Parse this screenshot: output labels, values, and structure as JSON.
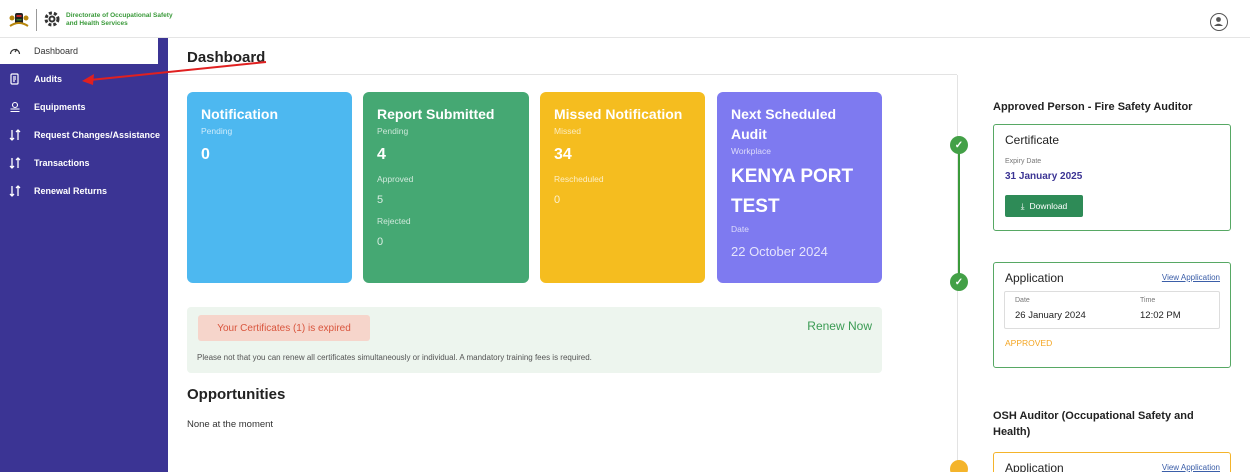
{
  "header": {
    "org_name_line1": "Directorate of Occupational Safety",
    "org_name_line2": "and Health Services"
  },
  "sidebar": {
    "items": [
      {
        "label": "Dashboard",
        "icon": "gauge-icon",
        "active": true
      },
      {
        "label": "Audits",
        "icon": "document-icon"
      },
      {
        "label": "Equipments",
        "icon": "gear-stack-icon"
      },
      {
        "label": "Request Changes/Assistance",
        "icon": "transfer-icon"
      },
      {
        "label": "Transactions",
        "icon": "transfer-icon"
      },
      {
        "label": "Renewal Returns",
        "icon": "transfer-icon"
      }
    ]
  },
  "page": {
    "title": "Dashboard"
  },
  "cards": {
    "notification": {
      "title": "Notification",
      "sub": "Pending",
      "value": "0",
      "color": "#4db8f0"
    },
    "report": {
      "title": "Report Submitted",
      "pending_label": "Pending",
      "pending_value": "4",
      "approved_label": "Approved",
      "approved_value": "5",
      "rejected_label": "Rejected",
      "rejected_value": "0",
      "color": "#45a873"
    },
    "missed": {
      "title": "Missed Notification",
      "missed_label": "Missed",
      "missed_value": "34",
      "rescheduled_label": "Rescheduled",
      "rescheduled_value": "0",
      "color": "#f5bd1f"
    },
    "scheduled": {
      "title_line1": "Next Scheduled",
      "title_line2": "Audit",
      "workplace_label": "Workplace",
      "workplace_line1": "KENYA PORT",
      "workplace_line2": "TEST",
      "date_label": "Date",
      "date_value": "22 October 2024",
      "color": "#7e7af0"
    }
  },
  "alert": {
    "expired_text": "Your Certificates (1) is expired",
    "renew_label": "Renew Now",
    "note": "Please not that you can renew all certificates simultaneously or individual. A mandatory training fees is required."
  },
  "opportunities": {
    "title": "Opportunities",
    "empty_text": "None at the moment"
  },
  "right_panel": {
    "section1_title": "Approved Person - Fire Safety Auditor",
    "certificate": {
      "title": "Certificate",
      "expiry_label": "Expiry Date",
      "expiry_value": "31 January 2025",
      "download_label": "Download"
    },
    "application": {
      "title": "Application",
      "link": "View Application",
      "date_label": "Date",
      "date_value": "26 January 2024",
      "time_label": "Time",
      "time_value": "12:02 PM",
      "status": "APPROVED"
    },
    "section2_title_line1": "OSH Auditor (Occupational Safety and",
    "section2_title_line2": "Health)",
    "application2": {
      "title": "Application",
      "link": "View Application"
    }
  },
  "colors": {
    "sidebar_bg": "#3b3494",
    "accent_green": "#43a047",
    "accent_orange": "#f4b42b",
    "annotation_arrow": "#e02020"
  }
}
